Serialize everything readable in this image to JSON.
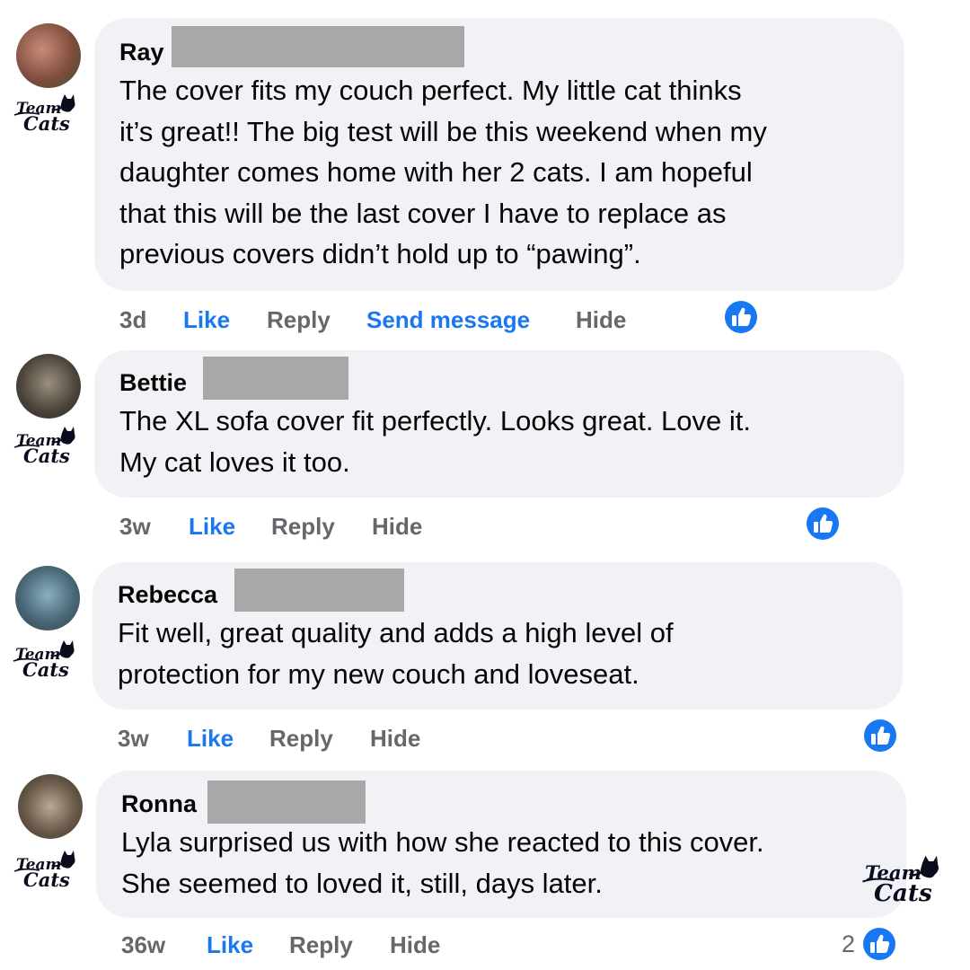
{
  "comments": [
    {
      "name": "Ray",
      "text": "The cover fits my couch perfect. My little cat thinks\nit’s great!! The big test will be this weekend when my\ndaughter comes home with her 2 cats. I am hopeful\nthat this will be the last cover I have to replace as\nprevious covers didn’t hold up to “pawing”.",
      "time": "3d",
      "like": "Like",
      "reply": "Reply",
      "send_message": "Send message",
      "hide": "Hide"
    },
    {
      "name": "Bettie",
      "text": "The XL sofa cover fit perfectly. Looks great. Love it.\nMy cat loves it too.",
      "time": "3w",
      "like": "Like",
      "reply": "Reply",
      "hide": "Hide"
    },
    {
      "name": "Rebecca",
      "text": "Fit well, great quality and adds a high level of\nprotection for my new couch and loveseat.",
      "time": "3w",
      "like": "Like",
      "reply": "Reply",
      "hide": "Hide"
    },
    {
      "name": "Ronna",
      "text": "Lyla surprised us with how she reacted to this cover.\nShe seemed to loved it, still, days later.",
      "time": "36w",
      "like": "Like",
      "reply": "Reply",
      "hide": "Hide",
      "reaction_count": "2"
    }
  ],
  "badge": {
    "line1": "Team",
    "line2": "Cats"
  },
  "colors": {
    "bubble": "#f0f2f5",
    "link_blue": "#1877f2",
    "muted": "#65676b",
    "redaction": "#a8a8a8"
  },
  "icons": {
    "reaction": "thumbs-up-icon",
    "badge": "team-cats-badge-icon"
  }
}
